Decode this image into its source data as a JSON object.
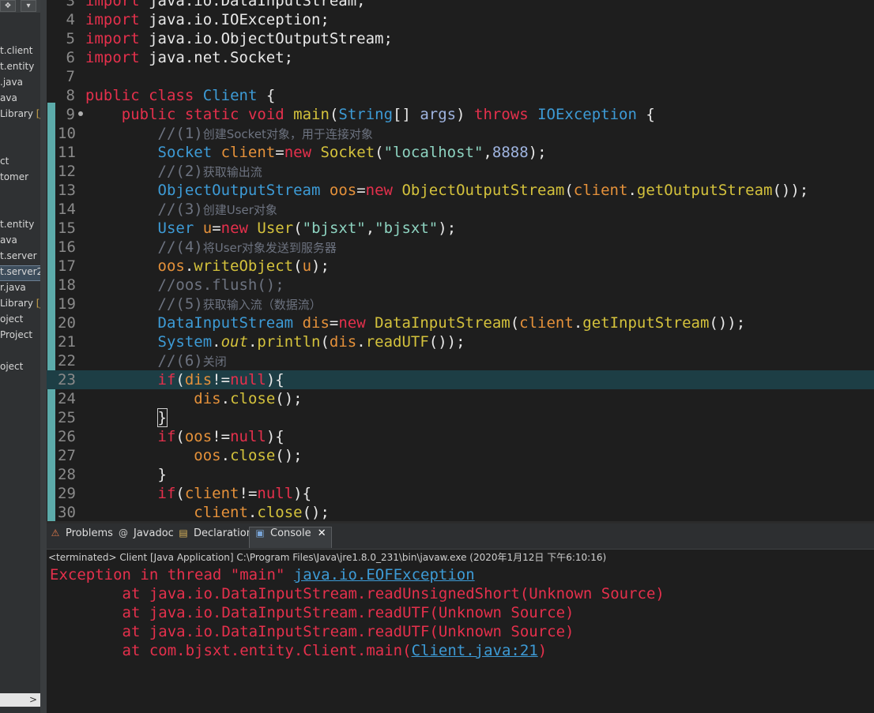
{
  "sidebar": {
    "items": [
      {
        "label": "t.client",
        "selected": false
      },
      {
        "label": "t.entity",
        "selected": false
      },
      {
        "label": ".java",
        "selected": false
      },
      {
        "label": "ava",
        "selected": false
      },
      {
        "label": "Library",
        "badge": "[J",
        "selected": false
      },
      {
        "label": "ct",
        "selected": false
      },
      {
        "label": "tomer",
        "selected": false
      },
      {
        "label": "t.entity",
        "selected": false
      },
      {
        "label": "ava",
        "selected": false
      },
      {
        "label": "t.server",
        "selected": false
      },
      {
        "label": "t.server2",
        "selected": true
      },
      {
        "label": "r.java",
        "selected": false
      },
      {
        "label": "Library",
        "badge": "[J",
        "selected": false
      },
      {
        "label": "oject",
        "selected": false
      },
      {
        "label": "Project",
        "selected": false
      },
      {
        "label": "oject",
        "selected": false
      }
    ],
    "scroll_arrow": ">"
  },
  "editor": {
    "lines": [
      {
        "n": "3",
        "code": [
          [
            "kw",
            "import"
          ],
          [
            "pl",
            " java.io.DataInputStream;"
          ]
        ]
      },
      {
        "n": "4",
        "code": [
          [
            "kw",
            "import"
          ],
          [
            "pl",
            " java.io.IOException;"
          ]
        ]
      },
      {
        "n": "5",
        "code": [
          [
            "kw",
            "import"
          ],
          [
            "pl",
            " java.io.ObjectOutputStream;"
          ]
        ]
      },
      {
        "n": "6",
        "code": [
          [
            "kw",
            "import"
          ],
          [
            "pl",
            " java.net.Socket;"
          ]
        ]
      },
      {
        "n": "7",
        "code": []
      },
      {
        "n": "8",
        "code": [
          [
            "kw",
            "public"
          ],
          [
            "pl",
            " "
          ],
          [
            "kw",
            "class"
          ],
          [
            "pl",
            " "
          ],
          [
            "ty",
            "Client"
          ],
          [
            "pl",
            " {"
          ]
        ]
      },
      {
        "n": "9",
        "fold": true,
        "code": [
          [
            "pl",
            "    "
          ],
          [
            "kw",
            "public"
          ],
          [
            "pl",
            " "
          ],
          [
            "kw",
            "static"
          ],
          [
            "pl",
            " "
          ],
          [
            "kw",
            "void"
          ],
          [
            "pl",
            " "
          ],
          [
            "fn",
            "main"
          ],
          [
            "pl",
            "("
          ],
          [
            "ty",
            "String"
          ],
          [
            "pl",
            "[] "
          ],
          [
            "nm",
            "args"
          ],
          [
            "pl",
            ") "
          ],
          [
            "kw",
            "throws"
          ],
          [
            "pl",
            " "
          ],
          [
            "ty",
            "IOException"
          ],
          [
            "pl",
            " {"
          ]
        ]
      },
      {
        "n": "10",
        "code": [
          [
            "pl",
            "        "
          ],
          [
            "cm",
            "//(1)"
          ],
          [
            "cmz",
            "创建Socket对象，用于连接对象"
          ]
        ]
      },
      {
        "n": "11",
        "code": [
          [
            "pl",
            "        "
          ],
          [
            "ty",
            "Socket"
          ],
          [
            "pl",
            " "
          ],
          [
            "vr",
            "client"
          ],
          [
            "pl",
            "="
          ],
          [
            "kw",
            "new"
          ],
          [
            "pl",
            " "
          ],
          [
            "fn",
            "Socket"
          ],
          [
            "pl",
            "("
          ],
          [
            "st",
            "\"localhost\""
          ],
          [
            "pl",
            ","
          ],
          [
            "nm",
            "8888"
          ],
          [
            "pl",
            ");"
          ]
        ]
      },
      {
        "n": "12",
        "code": [
          [
            "pl",
            "        "
          ],
          [
            "cm",
            "//(2)"
          ],
          [
            "cmz",
            "获取输出流"
          ]
        ]
      },
      {
        "n": "13",
        "code": [
          [
            "pl",
            "        "
          ],
          [
            "ty",
            "ObjectOutputStream"
          ],
          [
            "pl",
            " "
          ],
          [
            "vr",
            "oos"
          ],
          [
            "pl",
            "="
          ],
          [
            "kw",
            "new"
          ],
          [
            "pl",
            " "
          ],
          [
            "fn",
            "ObjectOutputStream"
          ],
          [
            "pl",
            "("
          ],
          [
            "vr",
            "client"
          ],
          [
            "pl",
            "."
          ],
          [
            "fn",
            "getOutputStream"
          ],
          [
            "pl",
            "());"
          ]
        ]
      },
      {
        "n": "14",
        "code": [
          [
            "pl",
            "        "
          ],
          [
            "cm",
            "//(3)"
          ],
          [
            "cmz",
            "创建User对象"
          ]
        ]
      },
      {
        "n": "15",
        "code": [
          [
            "pl",
            "        "
          ],
          [
            "ty",
            "User"
          ],
          [
            "pl",
            " "
          ],
          [
            "vr",
            "u"
          ],
          [
            "pl",
            "="
          ],
          [
            "kw",
            "new"
          ],
          [
            "pl",
            " "
          ],
          [
            "fn",
            "User"
          ],
          [
            "pl",
            "("
          ],
          [
            "st",
            "\"bjsxt\""
          ],
          [
            "pl",
            ","
          ],
          [
            "st",
            "\"bjsxt\""
          ],
          [
            "pl",
            ");"
          ]
        ]
      },
      {
        "n": "16",
        "code": [
          [
            "pl",
            "        "
          ],
          [
            "cm",
            "//(4)"
          ],
          [
            "cmz",
            "将User对象发送到服务器"
          ]
        ]
      },
      {
        "n": "17",
        "code": [
          [
            "pl",
            "        "
          ],
          [
            "vr",
            "oos"
          ],
          [
            "pl",
            "."
          ],
          [
            "fn",
            "writeObject"
          ],
          [
            "pl",
            "("
          ],
          [
            "vr",
            "u"
          ],
          [
            "pl",
            ");"
          ]
        ]
      },
      {
        "n": "18",
        "code": [
          [
            "pl",
            "        "
          ],
          [
            "cm",
            "//oos.flush();"
          ]
        ]
      },
      {
        "n": "19",
        "code": [
          [
            "pl",
            "        "
          ],
          [
            "cm",
            "//(5)"
          ],
          [
            "cmz",
            "获取输入流（数据流）"
          ]
        ]
      },
      {
        "n": "20",
        "code": [
          [
            "pl",
            "        "
          ],
          [
            "ty",
            "DataInputStream"
          ],
          [
            "pl",
            " "
          ],
          [
            "vr",
            "dis"
          ],
          [
            "pl",
            "="
          ],
          [
            "kw",
            "new"
          ],
          [
            "pl",
            " "
          ],
          [
            "fn",
            "DataInputStream"
          ],
          [
            "pl",
            "("
          ],
          [
            "vr",
            "client"
          ],
          [
            "pl",
            "."
          ],
          [
            "fn",
            "getInputStream"
          ],
          [
            "pl",
            "());"
          ]
        ]
      },
      {
        "n": "21",
        "code": [
          [
            "pl",
            "        "
          ],
          [
            "ty",
            "System"
          ],
          [
            "pl",
            "."
          ],
          [
            "it",
            "out"
          ],
          [
            "pl",
            "."
          ],
          [
            "fn",
            "println"
          ],
          [
            "pl",
            "("
          ],
          [
            "vr",
            "dis"
          ],
          [
            "pl",
            "."
          ],
          [
            "fn",
            "readUTF"
          ],
          [
            "pl",
            "());"
          ]
        ]
      },
      {
        "n": "22",
        "code": [
          [
            "pl",
            "        "
          ],
          [
            "cm",
            "//(6)"
          ],
          [
            "cmz",
            "关闭"
          ]
        ]
      },
      {
        "n": "23",
        "current": true,
        "code": [
          [
            "pl",
            "        "
          ],
          [
            "kw",
            "if"
          ],
          [
            "pl",
            "("
          ],
          [
            "vr",
            "dis"
          ],
          [
            "pl",
            "!="
          ],
          [
            "kw",
            "null"
          ],
          [
            "pl",
            "){"
          ]
        ]
      },
      {
        "n": "24",
        "code": [
          [
            "pl",
            "            "
          ],
          [
            "vr",
            "dis"
          ],
          [
            "pl",
            "."
          ],
          [
            "fn",
            "close"
          ],
          [
            "pl",
            "();"
          ]
        ]
      },
      {
        "n": "25",
        "code": [
          [
            "pl",
            "        "
          ],
          [
            "cur",
            "}"
          ]
        ]
      },
      {
        "n": "26",
        "code": [
          [
            "pl",
            "        "
          ],
          [
            "kw",
            "if"
          ],
          [
            "pl",
            "("
          ],
          [
            "vr",
            "oos"
          ],
          [
            "pl",
            "!="
          ],
          [
            "kw",
            "null"
          ],
          [
            "pl",
            "){"
          ]
        ]
      },
      {
        "n": "27",
        "code": [
          [
            "pl",
            "            "
          ],
          [
            "vr",
            "oos"
          ],
          [
            "pl",
            "."
          ],
          [
            "fn",
            "close"
          ],
          [
            "pl",
            "();"
          ]
        ]
      },
      {
        "n": "28",
        "code": [
          [
            "pl",
            "        }"
          ]
        ]
      },
      {
        "n": "29",
        "code": [
          [
            "pl",
            "        "
          ],
          [
            "kw",
            "if"
          ],
          [
            "pl",
            "("
          ],
          [
            "vr",
            "client"
          ],
          [
            "pl",
            "!="
          ],
          [
            "kw",
            "null"
          ],
          [
            "pl",
            "){"
          ]
        ]
      },
      {
        "n": "30",
        "code": [
          [
            "pl",
            "            "
          ],
          [
            "vr",
            "client"
          ],
          [
            "pl",
            "."
          ],
          [
            "fn",
            "close"
          ],
          [
            "pl",
            "();"
          ]
        ]
      }
    ]
  },
  "panel": {
    "tabs": [
      {
        "label": "Problems",
        "icon": "problems-icon",
        "glyph": "⚠",
        "color": "#e07a4a"
      },
      {
        "label": "Javadoc",
        "icon": "javadoc-icon",
        "glyph": "@",
        "color": "#c9c9c9"
      },
      {
        "label": "Declaration",
        "icon": "declaration-icon",
        "glyph": "▤",
        "color": "#d9b35a"
      },
      {
        "label": "Console",
        "icon": "console-icon",
        "glyph": "▣",
        "color": "#7aa6d8",
        "active": true
      }
    ],
    "close_glyph": "✕",
    "status": "<terminated> Client [Java Application] C:\\Program Files\\Java\\jre1.8.0_231\\bin\\javaw.exe (2020年1月12日 下午6:10:16)",
    "output": [
      {
        "text": "Exception in thread \"main\" ",
        "link": "java.io.EOFException",
        "after": ""
      },
      {
        "text": "        at java.io.DataInputStream.readUnsignedShort(Unknown Source)"
      },
      {
        "text": "        at java.io.DataInputStream.readUTF(Unknown Source)"
      },
      {
        "text": "        at java.io.DataInputStream.readUTF(Unknown Source)"
      },
      {
        "text": "        at com.bjsxt.entity.Client.main(",
        "link": "Client.java:21",
        "after": ")"
      }
    ]
  }
}
